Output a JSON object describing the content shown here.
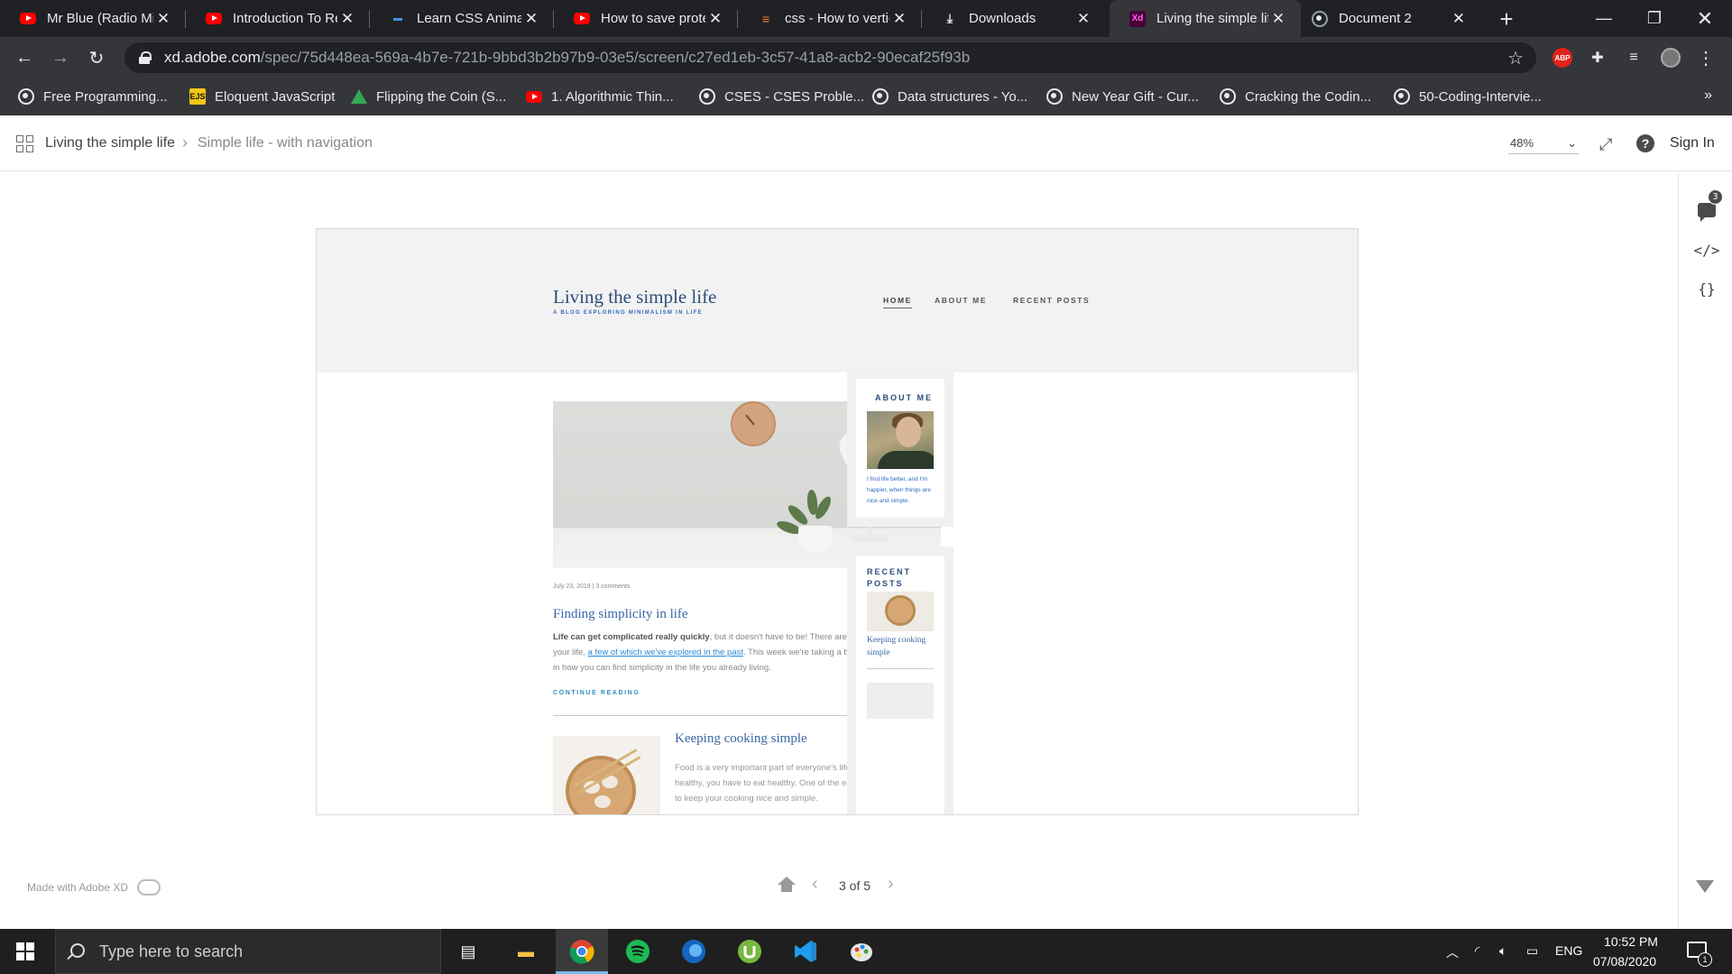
{
  "browser": {
    "tabs": [
      {
        "title": "Mr Blue (Radio Mix)",
        "icon": "youtube-icon"
      },
      {
        "title": "Introduction To React",
        "icon": "youtube-icon"
      },
      {
        "title": "Learn CSS Animation",
        "icon": "site-icon"
      },
      {
        "title": "How to save protected",
        "icon": "youtube-icon"
      },
      {
        "title": "css - How to vertically",
        "icon": "stackoverflow-icon"
      },
      {
        "title": "Downloads",
        "icon": "download-icon"
      },
      {
        "title": "Living the simple life",
        "icon": "adobe-xd-icon",
        "active": true
      },
      {
        "title": "Document 2",
        "icon": "globe-icon"
      }
    ],
    "url_host": "xd.adobe.com",
    "url_path": "/spec/75d448ea-569a-4b7e-721b-9bbd3b2b97b9-03e5/screen/c27ed1eb-3c57-41a8-acb2-90ecaf25f93b",
    "bookmarks": [
      {
        "label": "Free Programming...",
        "icon": "globe-icon"
      },
      {
        "label": "Eloquent JavaScript",
        "icon": "ejs-icon"
      },
      {
        "label": "Flipping the Coin (S...",
        "icon": "drive-icon"
      },
      {
        "label": "1. Algorithmic Thin...",
        "icon": "youtube-icon"
      },
      {
        "label": "CSES - CSES Proble...",
        "icon": "globe-icon"
      },
      {
        "label": "Data structures - Yo...",
        "icon": "globe-icon"
      },
      {
        "label": "New Year Gift - Cur...",
        "icon": "globe-icon"
      },
      {
        "label": "Cracking the Codin...",
        "icon": "globe-icon"
      },
      {
        "label": "50-Coding-Intervie...",
        "icon": "globe-icon"
      }
    ],
    "abp_label": "ABP",
    "more_label": "»"
  },
  "xd": {
    "breadcrumb_root": "Living the simple life",
    "breadcrumb_sep": "›",
    "breadcrumb_child": "Simple life - with navigation",
    "zoom": "48%",
    "sign_in": "Sign In",
    "help": "?",
    "comment_count": "3",
    "code_icon": "</>",
    "braces_icon": "{}",
    "made_with": "Made with Adobe XD",
    "pager": "3 of 5",
    "prev": "‹",
    "next": "›"
  },
  "site": {
    "title": "Living the simple life",
    "tagline": "A BLOG EXPLORING MINIMALISM IN LIFE",
    "nav": [
      "HOME",
      "ABOUT ME",
      "RECENT POSTS"
    ],
    "post1": {
      "meta": "July 23, 2019  |  3 comments",
      "title": "Finding simplicity in life",
      "lead": "Life can get complicated really quickly",
      "body1": ", but it doesn't have to be! There are many ways to simplify your life, ",
      "link": "a few of which we've explored in the past",
      "body2": ". This week we're taking a bit of a approach though, in how you can find simplicity in the life you already living.",
      "continue": "CONTINUE READING"
    },
    "post2": {
      "title": "Keeping cooking simple",
      "excerpt": "Food is a very important part of everyone's life. If you want to be healthy, you have to eat healthy. One of the easiest ways to do that is to keep your cooking nice and simple."
    },
    "about": {
      "title": "ABOUT ME",
      "text": "I find life better, and I'm happier, when things are nice and simple."
    },
    "recent": {
      "title": "RECENT POSTS",
      "link": "Keeping cooking simple"
    }
  },
  "taskbar": {
    "search_placeholder": "Type here to search",
    "language": "ENG",
    "time": "10:52 PM",
    "date": "07/08/2020",
    "notifications": "1"
  }
}
